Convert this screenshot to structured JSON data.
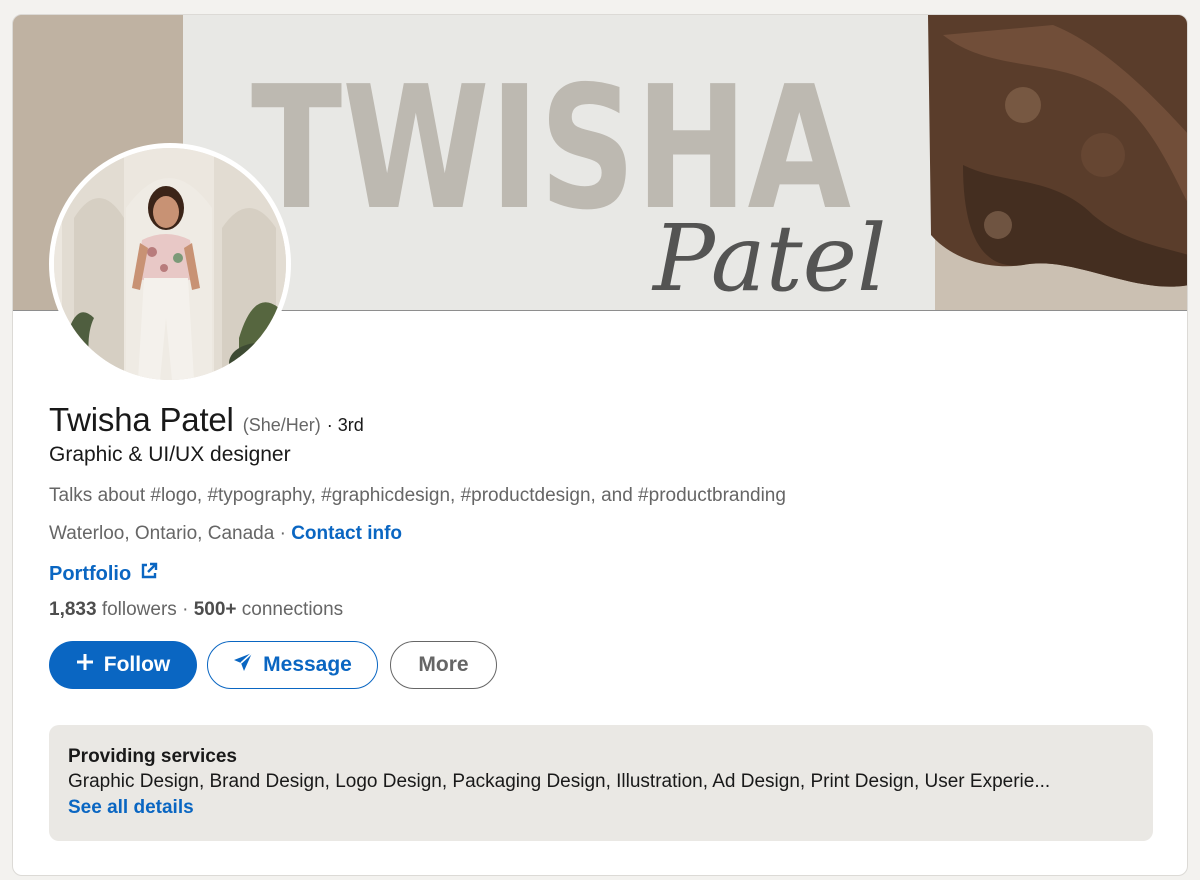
{
  "profile": {
    "name": "Twisha Patel",
    "pronouns": "(She/Her)",
    "degree": "· 3rd",
    "headline": "Graphic & UI/UX designer",
    "talks_about": "Talks about #logo, #typography, #graphicdesign, #productdesign, and #productbranding",
    "location": "Waterloo, Ontario, Canada",
    "location_sep": " · ",
    "contact_info": "Contact info",
    "portfolio": "Portfolio",
    "followers_count": "1,833",
    "followers_label": "followers",
    "connections_sep": " · ",
    "connections_count": "500+",
    "connections_label": "connections"
  },
  "banner": {
    "print_word": "TWISHA",
    "script_word": "Patel"
  },
  "actions": {
    "follow": "Follow",
    "message": "Message",
    "more": "More"
  },
  "services": {
    "title": "Providing services",
    "list": "Graphic Design, Brand Design, Logo Design, Packaging Design, Illustration, Ad Design, Print Design, User Experie...",
    "see_all": "See all details"
  },
  "colors": {
    "accent": "#0a66c2",
    "page_bg": "#f3f2ef",
    "services_bg": "#eae8e4"
  },
  "icons": {
    "follow": "plus-icon",
    "message": "send-icon",
    "portfolio": "external-link-icon"
  }
}
